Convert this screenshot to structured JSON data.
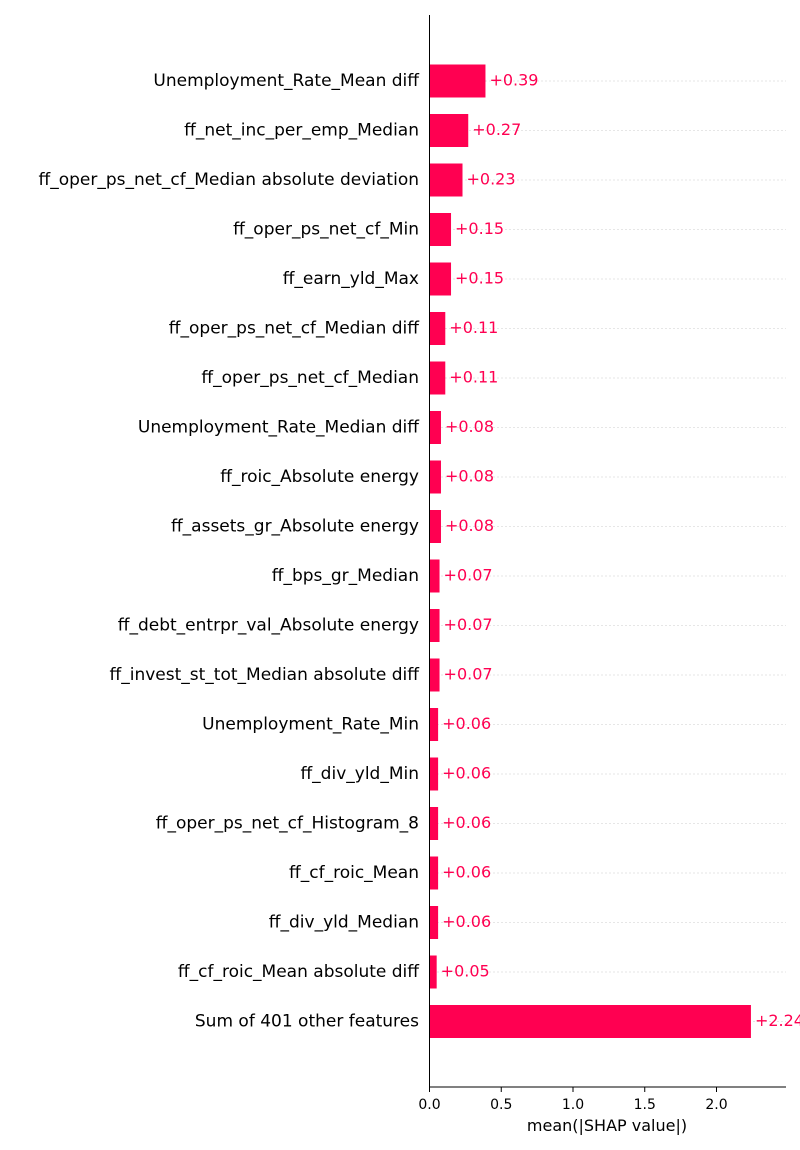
{
  "chart_data": {
    "type": "bar",
    "orientation": "horizontal",
    "categories": [
      "Unemployment_Rate_Mean diff",
      "ff_net_inc_per_emp_Median",
      "ff_oper_ps_net_cf_Median absolute deviation",
      "ff_oper_ps_net_cf_Min",
      "ff_earn_yld_Max",
      "ff_oper_ps_net_cf_Median diff",
      "ff_oper_ps_net_cf_Median",
      "Unemployment_Rate_Median diff",
      "ff_roic_Absolute energy",
      "ff_assets_gr_Absolute energy",
      "ff_bps_gr_Median",
      "ff_debt_entrpr_val_Absolute energy",
      "ff_invest_st_tot_Median absolute diff",
      "Unemployment_Rate_Min",
      "ff_div_yld_Min",
      "ff_oper_ps_net_cf_Histogram_8",
      "ff_cf_roic_Mean",
      "ff_div_yld_Median",
      "ff_cf_roic_Mean absolute diff",
      "Sum of 401 other features"
    ],
    "values": [
      0.39,
      0.27,
      0.23,
      0.15,
      0.15,
      0.11,
      0.11,
      0.08,
      0.08,
      0.08,
      0.07,
      0.07,
      0.07,
      0.06,
      0.06,
      0.06,
      0.06,
      0.06,
      0.05,
      2.24
    ],
    "value_labels": [
      "+0.39",
      "+0.27",
      "+0.23",
      "+0.15",
      "+0.15",
      "+0.11",
      "+0.11",
      "+0.08",
      "+0.08",
      "+0.08",
      "+0.07",
      "+0.07",
      "+0.07",
      "+0.06",
      "+0.06",
      "+0.06",
      "+0.06",
      "+0.06",
      "+0.05",
      "+2.24"
    ],
    "xlabel": "mean(|SHAP value|)",
    "ylabel": "",
    "title": "",
    "xlim": [
      0,
      2.48
    ],
    "xticks": [
      0.0,
      0.5,
      1.0,
      1.5,
      2.0
    ],
    "xtick_labels": [
      "0.0",
      "0.5",
      "1.0",
      "1.5",
      "2.0"
    ],
    "grid": "horizontal dotted lines per feature",
    "bar_color": "#ff0051",
    "value_label_color": "#ff0051"
  }
}
